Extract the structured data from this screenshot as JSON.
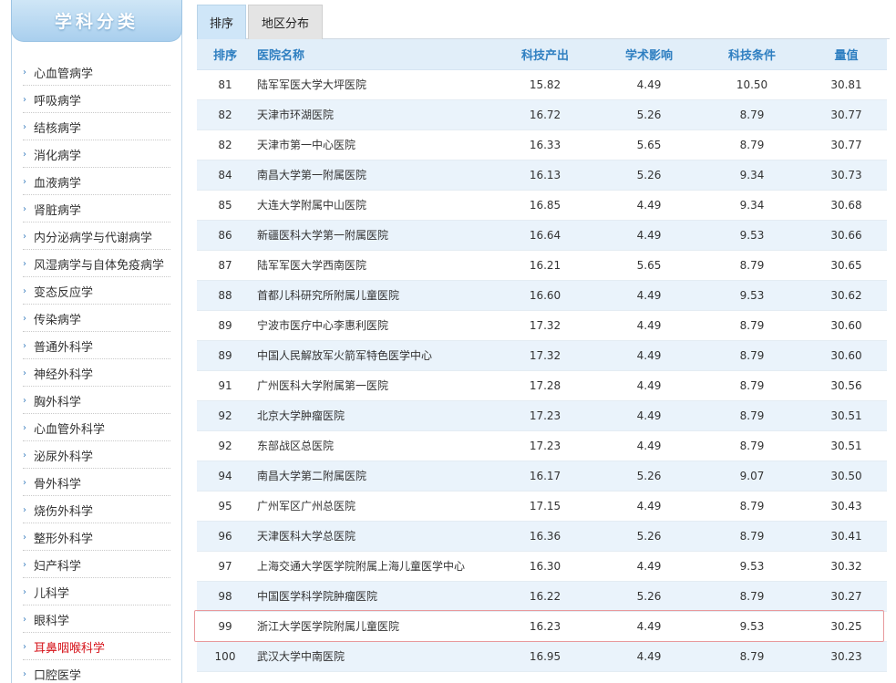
{
  "sidebar": {
    "title": "学科分类",
    "items": [
      {
        "label": "心血管病学",
        "active": false
      },
      {
        "label": "呼吸病学",
        "active": false
      },
      {
        "label": "结核病学",
        "active": false
      },
      {
        "label": "消化病学",
        "active": false
      },
      {
        "label": "血液病学",
        "active": false
      },
      {
        "label": "肾脏病学",
        "active": false
      },
      {
        "label": "内分泌病学与代谢病学",
        "active": false
      },
      {
        "label": "风湿病学与自体免疫病学",
        "active": false
      },
      {
        "label": "变态反应学",
        "active": false
      },
      {
        "label": "传染病学",
        "active": false
      },
      {
        "label": "普通外科学",
        "active": false
      },
      {
        "label": "神经外科学",
        "active": false
      },
      {
        "label": "胸外科学",
        "active": false
      },
      {
        "label": "心血管外科学",
        "active": false
      },
      {
        "label": "泌尿外科学",
        "active": false
      },
      {
        "label": "骨外科学",
        "active": false
      },
      {
        "label": "烧伤外科学",
        "active": false
      },
      {
        "label": "整形外科学",
        "active": false
      },
      {
        "label": "妇产科学",
        "active": false
      },
      {
        "label": "儿科学",
        "active": false
      },
      {
        "label": "眼科学",
        "active": false
      },
      {
        "label": "耳鼻咽喉科学",
        "active": true
      },
      {
        "label": "口腔医学",
        "active": false
      }
    ]
  },
  "tabs": {
    "rank": "排序",
    "region": "地区分布"
  },
  "table": {
    "headers": {
      "rank": "排序",
      "name": "医院名称",
      "tech_output": "科技产出",
      "academic_impact": "学术影响",
      "tech_conditions": "科技条件",
      "score": "量值"
    },
    "highlight_rank_index": 18,
    "rows": [
      {
        "rank": "81",
        "name": "陆军军医大学大坪医院",
        "tech_output": "15.82",
        "academic_impact": "4.49",
        "tech_conditions": "10.50",
        "score": "30.81"
      },
      {
        "rank": "82",
        "name": "天津市环湖医院",
        "tech_output": "16.72",
        "academic_impact": "5.26",
        "tech_conditions": "8.79",
        "score": "30.77"
      },
      {
        "rank": "82",
        "name": "天津市第一中心医院",
        "tech_output": "16.33",
        "academic_impact": "5.65",
        "tech_conditions": "8.79",
        "score": "30.77"
      },
      {
        "rank": "84",
        "name": "南昌大学第一附属医院",
        "tech_output": "16.13",
        "academic_impact": "5.26",
        "tech_conditions": "9.34",
        "score": "30.73"
      },
      {
        "rank": "85",
        "name": "大连大学附属中山医院",
        "tech_output": "16.85",
        "academic_impact": "4.49",
        "tech_conditions": "9.34",
        "score": "30.68"
      },
      {
        "rank": "86",
        "name": "新疆医科大学第一附属医院",
        "tech_output": "16.64",
        "academic_impact": "4.49",
        "tech_conditions": "9.53",
        "score": "30.66"
      },
      {
        "rank": "87",
        "name": "陆军军医大学西南医院",
        "tech_output": "16.21",
        "academic_impact": "5.65",
        "tech_conditions": "8.79",
        "score": "30.65"
      },
      {
        "rank": "88",
        "name": "首都儿科研究所附属儿童医院",
        "tech_output": "16.60",
        "academic_impact": "4.49",
        "tech_conditions": "9.53",
        "score": "30.62"
      },
      {
        "rank": "89",
        "name": "宁波市医疗中心李惠利医院",
        "tech_output": "17.32",
        "academic_impact": "4.49",
        "tech_conditions": "8.79",
        "score": "30.60"
      },
      {
        "rank": "89",
        "name": "中国人民解放军火箭军特色医学中心",
        "tech_output": "17.32",
        "academic_impact": "4.49",
        "tech_conditions": "8.79",
        "score": "30.60"
      },
      {
        "rank": "91",
        "name": "广州医科大学附属第一医院",
        "tech_output": "17.28",
        "academic_impact": "4.49",
        "tech_conditions": "8.79",
        "score": "30.56"
      },
      {
        "rank": "92",
        "name": "北京大学肿瘤医院",
        "tech_output": "17.23",
        "academic_impact": "4.49",
        "tech_conditions": "8.79",
        "score": "30.51"
      },
      {
        "rank": "92",
        "name": "东部战区总医院",
        "tech_output": "17.23",
        "academic_impact": "4.49",
        "tech_conditions": "8.79",
        "score": "30.51"
      },
      {
        "rank": "94",
        "name": "南昌大学第二附属医院",
        "tech_output": "16.17",
        "academic_impact": "5.26",
        "tech_conditions": "9.07",
        "score": "30.50"
      },
      {
        "rank": "95",
        "name": "广州军区广州总医院",
        "tech_output": "17.15",
        "academic_impact": "4.49",
        "tech_conditions": "8.79",
        "score": "30.43"
      },
      {
        "rank": "96",
        "name": "天津医科大学总医院",
        "tech_output": "16.36",
        "academic_impact": "5.26",
        "tech_conditions": "8.79",
        "score": "30.41"
      },
      {
        "rank": "97",
        "name": "上海交通大学医学院附属上海儿童医学中心",
        "tech_output": "16.30",
        "academic_impact": "4.49",
        "tech_conditions": "9.53",
        "score": "30.32"
      },
      {
        "rank": "98",
        "name": "中国医学科学院肿瘤医院",
        "tech_output": "16.22",
        "academic_impact": "5.26",
        "tech_conditions": "8.79",
        "score": "30.27"
      },
      {
        "rank": "99",
        "name": "浙江大学医学院附属儿童医院",
        "tech_output": "16.23",
        "academic_impact": "4.49",
        "tech_conditions": "9.53",
        "score": "30.25"
      },
      {
        "rank": "100",
        "name": "武汉大学中南医院",
        "tech_output": "16.95",
        "academic_impact": "4.49",
        "tech_conditions": "8.79",
        "score": "30.23"
      }
    ]
  }
}
